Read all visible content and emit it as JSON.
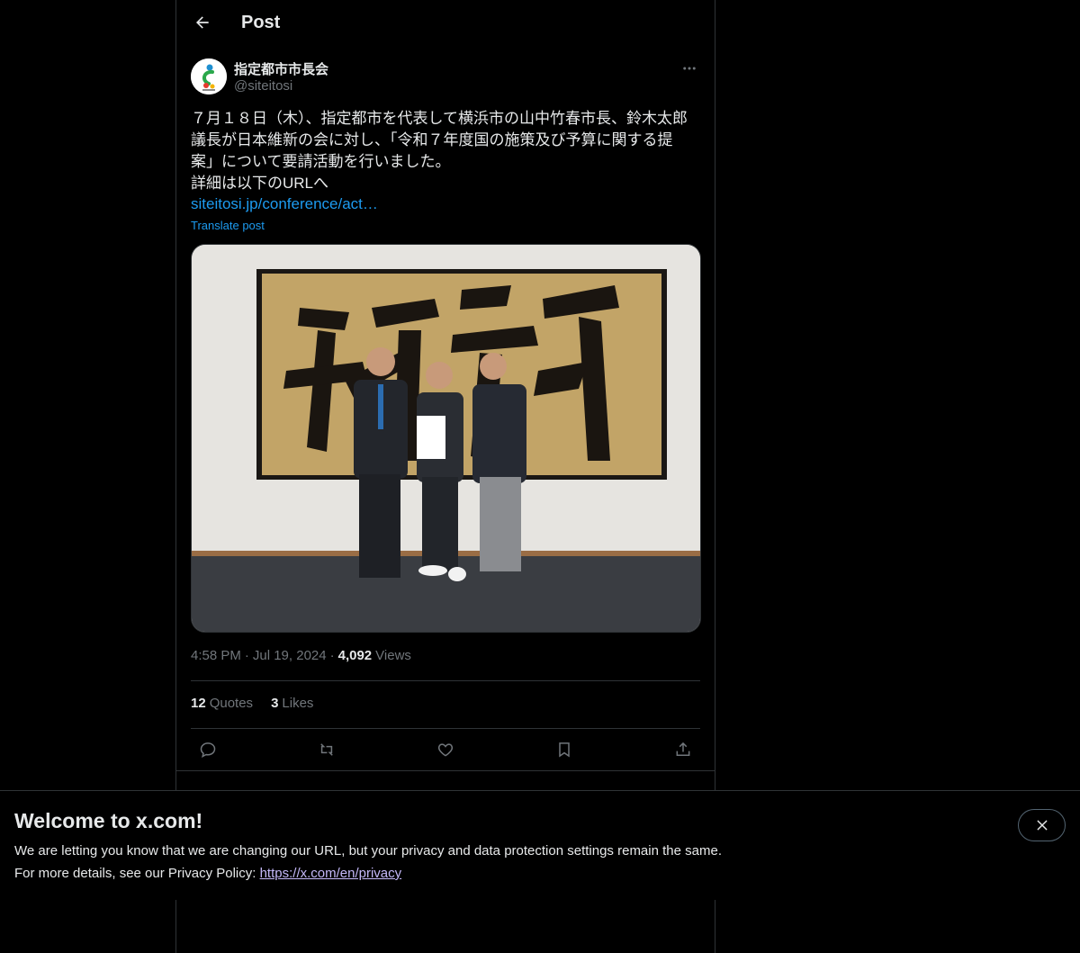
{
  "header": {
    "title": "Post"
  },
  "author": {
    "name": "指定都市市長会",
    "handle": "@siteitosi"
  },
  "post": {
    "text": "７月１８日（木）、指定都市を代表して横浜市の山中竹春市長、鈴木太郎\n議長が日本維新の会に対し、「令和７年度国の施策及び予算に関する提\n案」について要請活動を行いました。\n詳細は以下のURLへ",
    "link": "siteitosi.jp/conference/act…",
    "translate": "Translate post",
    "time": "4:58 PM",
    "date": "Jul 19, 2024",
    "views": "4,092",
    "views_label": "Views",
    "separator": "·"
  },
  "stats": {
    "quotes_count": "12",
    "quotes_label": "Quotes",
    "likes_count": "3",
    "likes_label": "Likes"
  },
  "banner": {
    "title": "Welcome to x.com!",
    "line1": "We are letting you know that we are changing our URL, but your privacy and data protection settings remain the same.",
    "line2_prefix": "For more details, see our Privacy Policy: ",
    "line2_link": "https://x.com/en/privacy"
  },
  "colors": {
    "accent": "#1d9bf0",
    "background": "#000000",
    "text": "#e7e9ea",
    "muted": "#71767b",
    "border": "#2f3336"
  },
  "icons": [
    "back-arrow-icon",
    "more-icon",
    "reply-icon",
    "repost-icon",
    "like-icon",
    "bookmark-icon",
    "share-icon",
    "close-icon"
  ]
}
